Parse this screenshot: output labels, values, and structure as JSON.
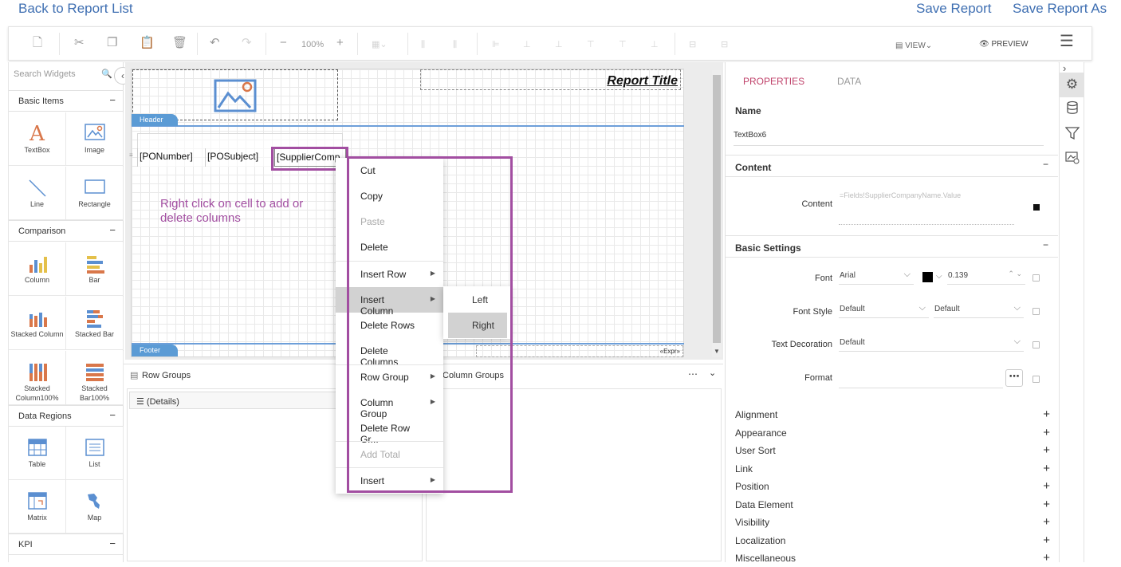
{
  "links": {
    "back": "Back to Report List",
    "save": "Save Report",
    "save_as": "Save Report As"
  },
  "toolbar": {
    "zoom": "100%",
    "view": "VIEW",
    "preview": "PREVIEW"
  },
  "left": {
    "search_placeholder": "Search Widgets",
    "sections": {
      "basic": "Basic Items",
      "comparison": "Comparison",
      "data_regions": "Data Regions",
      "kpi": "KPI"
    },
    "widgets": {
      "textbox": "TextBox",
      "image": "Image",
      "line": "Line",
      "rectangle": "Rectangle",
      "column": "Column",
      "bar": "Bar",
      "stacked_column": "Stacked Column",
      "stacked_bar": "Stacked Bar",
      "stacked_column100": "Stacked Column100%",
      "stacked_bar100": "Stacked Bar100%",
      "table": "Table",
      "list": "List",
      "matrix": "Matrix",
      "map": "Map"
    }
  },
  "design": {
    "report_title": "Report Title",
    "header_band": "Header",
    "footer_band": "Footer",
    "cells": [
      "[PONumber]",
      "[POSubject]",
      "[SupplierComp"
    ],
    "annotation": "Right click on cell to add or delete columns",
    "expr": "«Expr»"
  },
  "context_menu": {
    "items": [
      "Cut",
      "Copy",
      "Paste",
      "Delete",
      "Insert Row",
      "Insert Column",
      "Delete Rows",
      "Delete Columns",
      "Row Group",
      "Column Group",
      "Delete Row Gr...",
      "Add Total",
      "Insert"
    ],
    "submenu": [
      "Left",
      "Right"
    ]
  },
  "groups": {
    "row_title": "Row Groups",
    "column_title": "Column Groups",
    "details": "(Details)"
  },
  "properties": {
    "tabs": [
      "PROPERTIES",
      "DATA"
    ],
    "name_label": "Name",
    "name_value": "TextBox6",
    "content_section": "Content",
    "content_label": "Content",
    "content_value": "=Fields!SupplierCompanyName.Value",
    "basic_section": "Basic Settings",
    "font_label": "Font",
    "font_value": "Arial",
    "font_size": "0.139",
    "font_color": "#000000",
    "font_style_label": "Font Style",
    "font_style_value": "Default",
    "font_weight_value": "Default",
    "text_decoration_label": "Text Decoration",
    "text_decoration_value": "Default",
    "format_label": "Format",
    "accordions": [
      "Alignment",
      "Appearance",
      "User Sort",
      "Link",
      "Position",
      "Data Element",
      "Visibility",
      "Localization",
      "Miscellaneous"
    ]
  },
  "colors": {
    "accent": "#a24ea1",
    "active_tab": "#c0436b",
    "link": "#3f6fb2",
    "band": "#5b9bd5"
  }
}
